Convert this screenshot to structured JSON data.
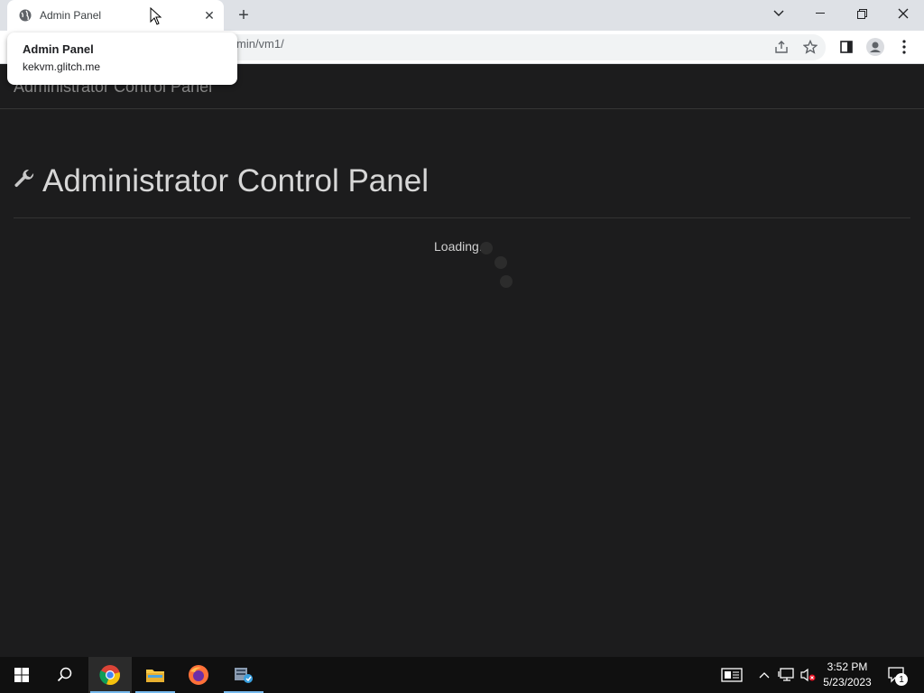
{
  "browser": {
    "tab_title": "Admin Panel",
    "url": "min/vm1/",
    "tooltip": {
      "title": "Admin Panel",
      "domain": "kekvm.glitch.me"
    }
  },
  "page": {
    "navbar_brand": "Administrator Control Panel",
    "heading": "Administrator Control Panel",
    "loading_text": "Loading..."
  },
  "taskbar": {
    "time": "3:52 PM",
    "date": "5/23/2023",
    "notification_count": "1",
    "apps": [
      "start-icon",
      "search-icon",
      "chrome-icon",
      "file-explorer-icon",
      "firefox-icon",
      "server-manager-icon"
    ]
  },
  "colors": {
    "accent": "#76b9ed",
    "page_bg": "#1c1c1d"
  }
}
